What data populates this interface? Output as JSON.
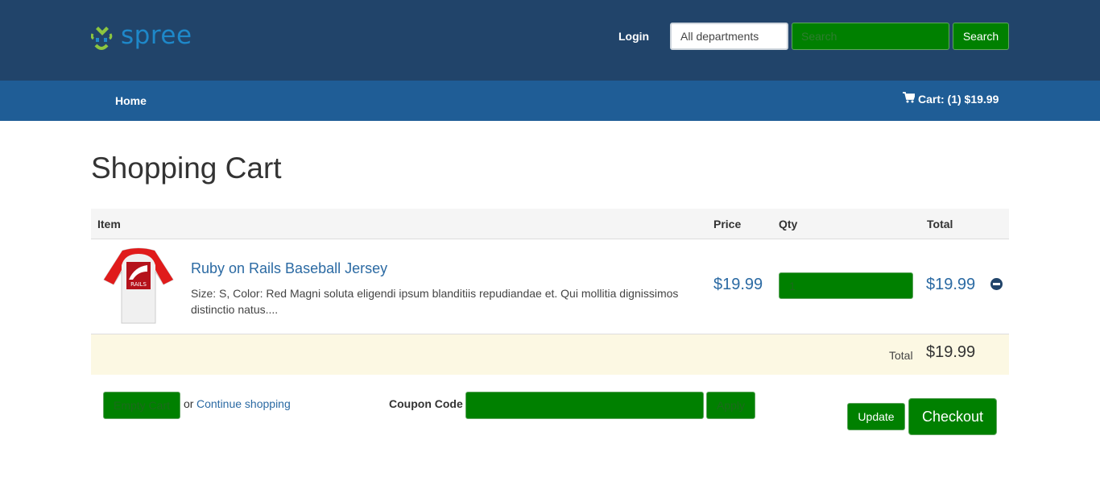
{
  "header": {
    "logo_text": "spree",
    "login_label": "Login",
    "department_select": "All departments",
    "search_placeholder": "Search",
    "search_button": "Search"
  },
  "nav": {
    "home_label": "Home",
    "cart_label": "Cart: (1) $19.99"
  },
  "page_title": "Shopping Cart",
  "table": {
    "headers": {
      "item": "Item",
      "price": "Price",
      "qty": "Qty",
      "total": "Total"
    },
    "rows": [
      {
        "name": "Ruby on Rails Baseball Jersey",
        "description": "Size: S, Color: Red Magni soluta eligendi ipsum blanditiis repudiandae et. Qui mollitia dignissimos distinctio natus....",
        "price": "$19.99",
        "quantity": "1",
        "total": "$19.99",
        "thumbnail_icon": "baseball-jersey-image"
      }
    ],
    "total_label": "Total",
    "total_value": "$19.99"
  },
  "actions": {
    "empty_cart": "Empty Cart",
    "or_text": "or",
    "continue_shopping": "Continue shopping",
    "coupon_label": "Coupon Code",
    "apply": "Apply",
    "update": "Update",
    "checkout": "Checkout"
  },
  "colors": {
    "header_bg": "#21446a",
    "nav_bg": "#1f5d96",
    "button_green": "#008000",
    "link_blue": "#2b6aa3",
    "total_row_bg": "#fcf8e3"
  }
}
